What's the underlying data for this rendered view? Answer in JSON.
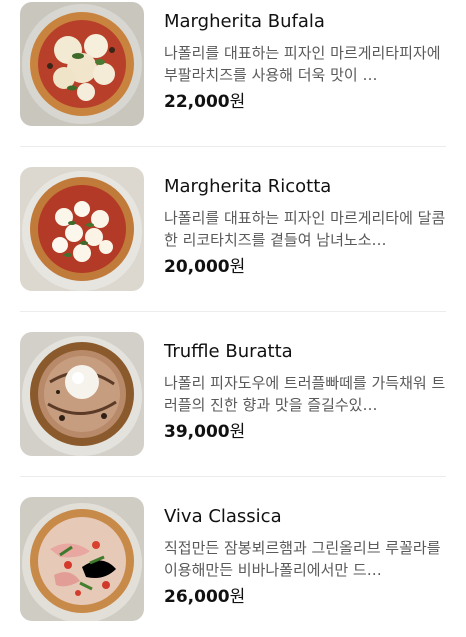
{
  "menu": {
    "items": [
      {
        "name": "Margherita Bufala",
        "description": "나폴리를 대표하는 피자인 마르게리타피자에 부팔라치즈를 사용해 더욱 맛이 …",
        "price": "22,000",
        "currency": "원",
        "image": "margherita-bufala-pizza-photo"
      },
      {
        "name": "Margherita Ricotta",
        "description": "나폴리를 대표하는 피자인 마르게리타에 달콤한 리코타치즈를 곁들여 남녀노소…",
        "price": "20,000",
        "currency": "원",
        "image": "margherita-ricotta-pizza-photo"
      },
      {
        "name": "Truffle Buratta",
        "description": "나폴리 피자도우에 트러플빠떼를 가득채워 트러플의 진한 향과 맛을 즐길수있…",
        "price": "39,000",
        "currency": "원",
        "image": "truffle-buratta-pizza-photo"
      },
      {
        "name": "Viva Classica",
        "description": "직접만든 잠봉뵈르햄과 그린올리브 루꼴라를 이용해만든 비바나폴리에서만 드…",
        "price": "26,000",
        "currency": "원",
        "image": "viva-classica-pizza-photo"
      }
    ]
  }
}
